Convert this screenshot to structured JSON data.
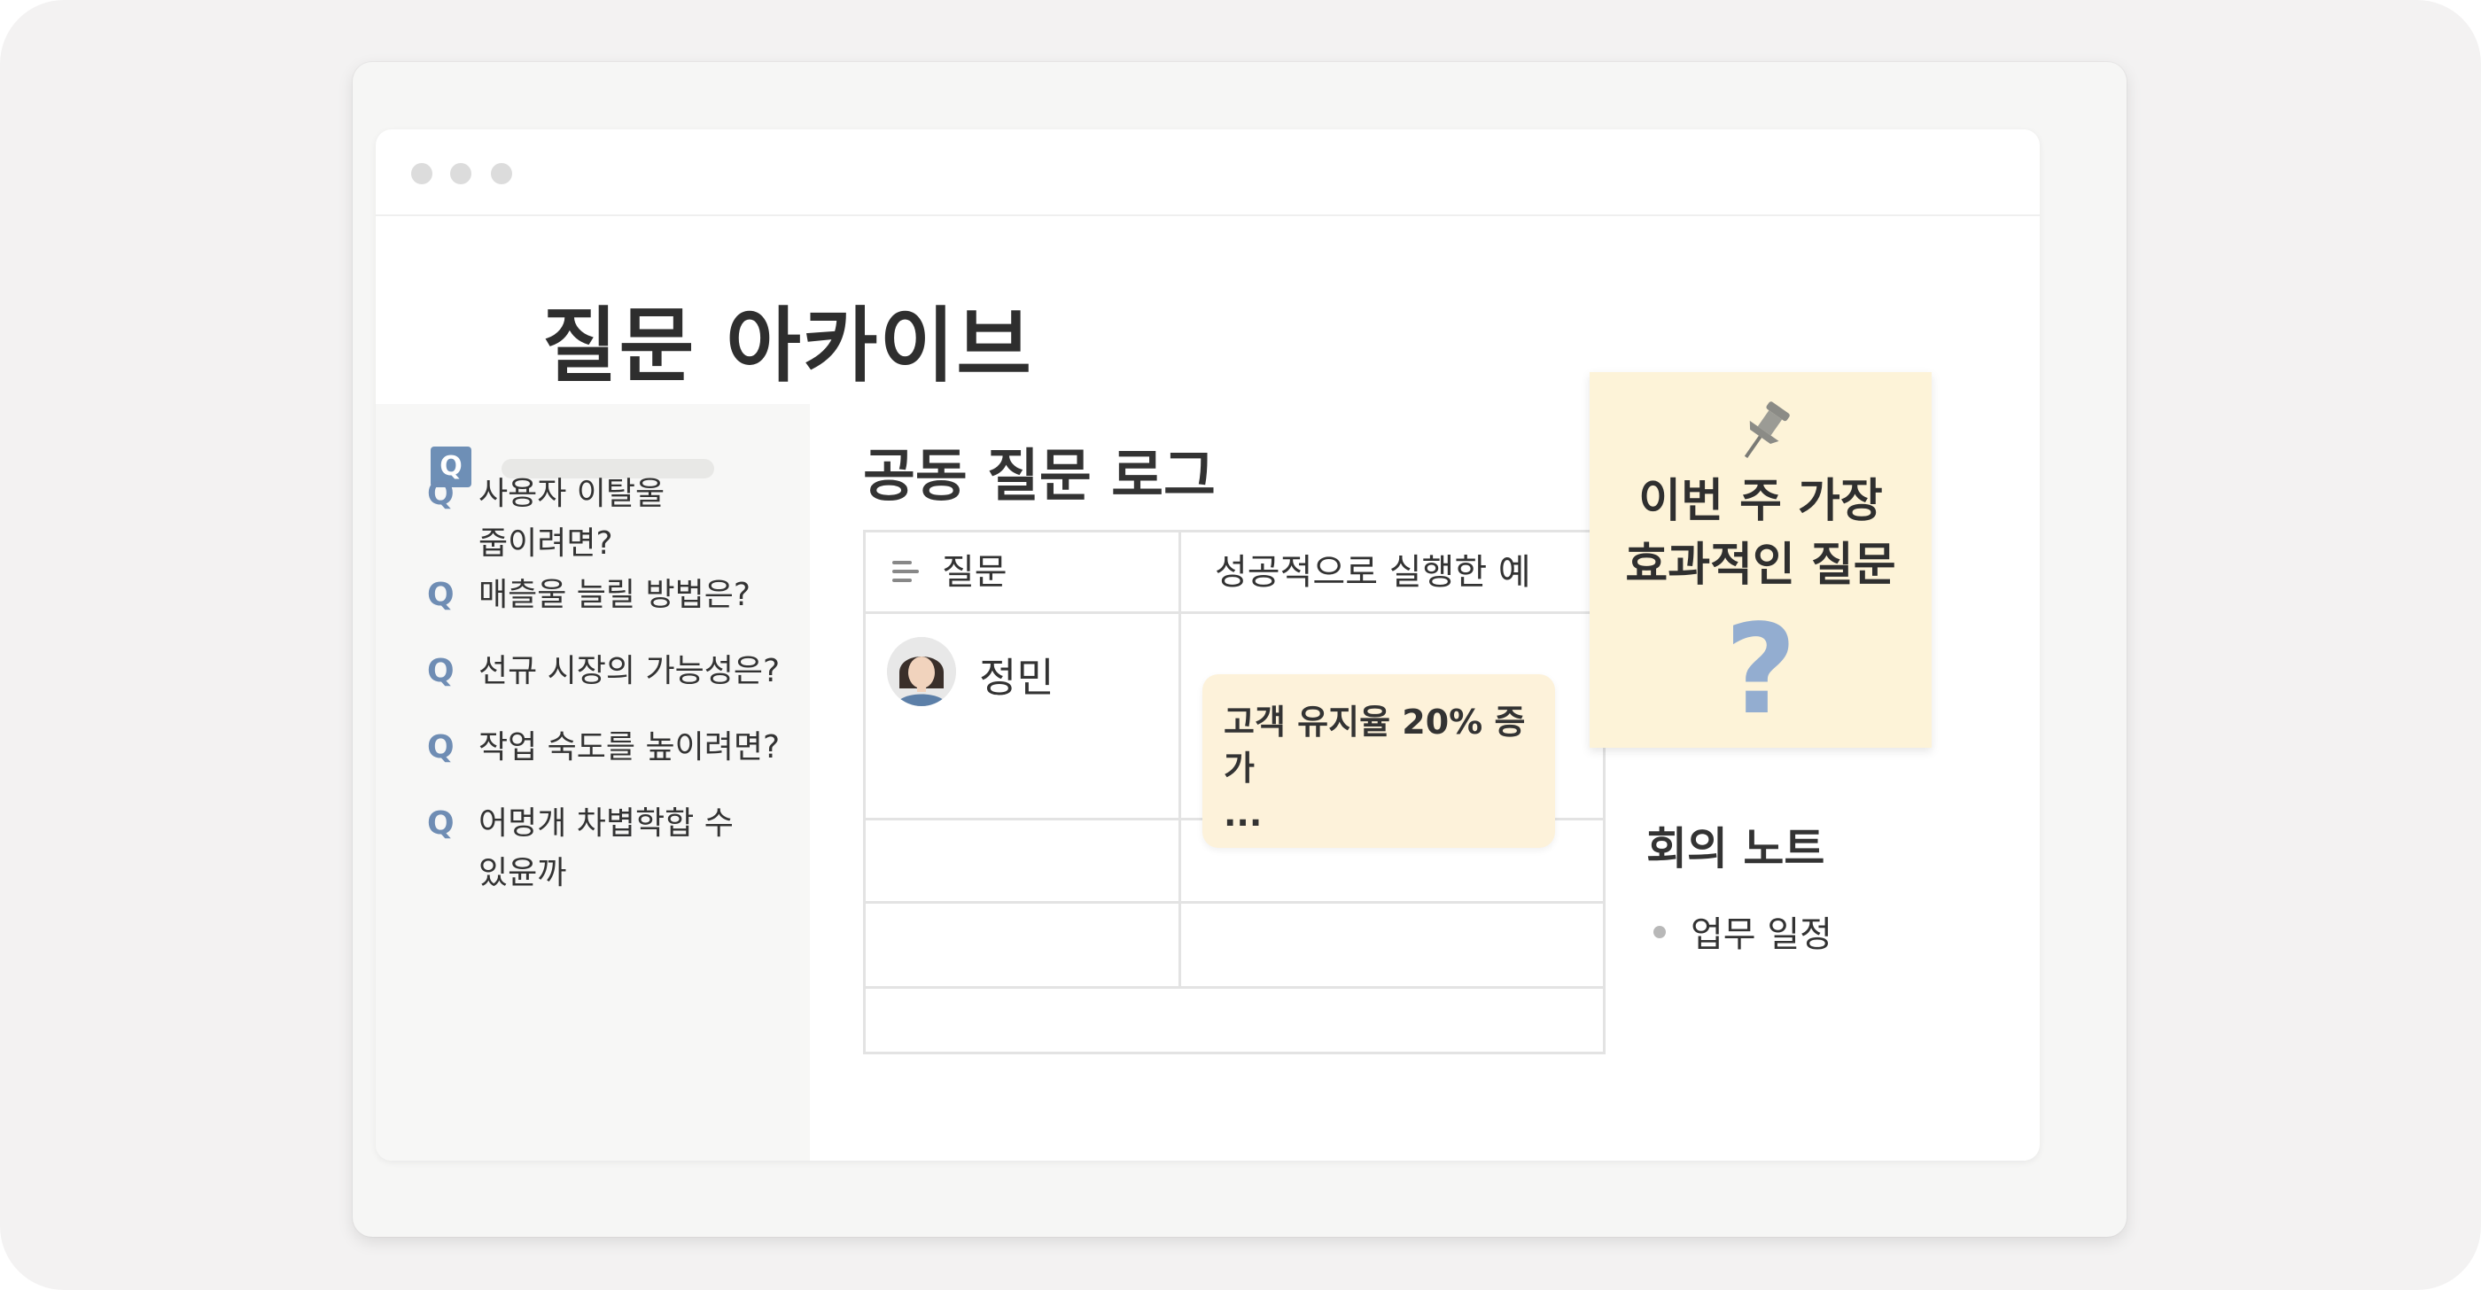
{
  "window": {
    "title": "질문 아카이브"
  },
  "sidebar": {
    "items": [
      {
        "line1": "사용자 이탈울",
        "line2": "줍이려면?"
      },
      {
        "line1": "매츨울 늘릴 방법은?",
        "line2": ""
      },
      {
        "line1": "선규 시장의 가능성은?",
        "line2": ""
      },
      {
        "line1": "작업 숙도를 높이려면?",
        "line2": ""
      },
      {
        "line1": "어멍개 차볍학합 수",
        "line2": "있윤까"
      }
    ]
  },
  "log": {
    "title": "공동 질문 로그",
    "columns": [
      "질문",
      "성공적으로 실행한 예"
    ],
    "rows": [
      {
        "name": "정민",
        "example": "고객 유지율 20% 증가",
        "example_more": "..."
      }
    ]
  },
  "sticky": {
    "line1": "이번 주 가장",
    "line2": "효과적인 질문",
    "symbol": "?"
  },
  "notes": {
    "title": "회의 노트",
    "items": [
      "업무 일정"
    ]
  },
  "colors": {
    "accent": "#6f8db4",
    "sticky": "#fdf3d8",
    "card": "#fdf2da",
    "question_mark": "#93add0"
  }
}
